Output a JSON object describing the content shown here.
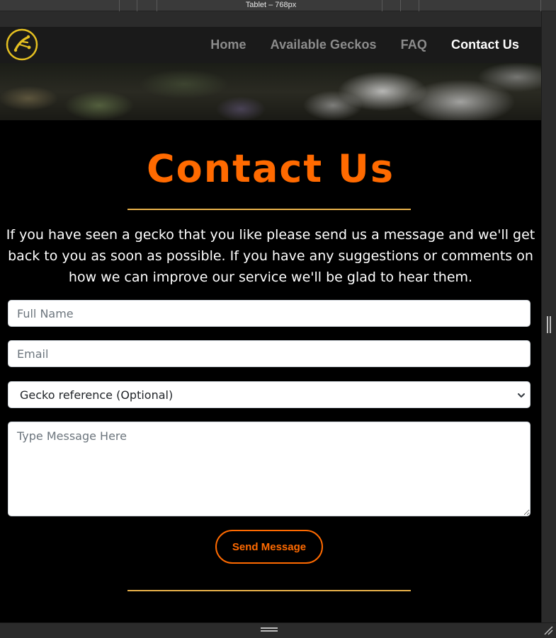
{
  "devtools": {
    "device_label": "Tablet – 768px"
  },
  "nav": {
    "links": [
      "Home",
      "Available Geckos",
      "FAQ",
      "Contact Us"
    ],
    "active": "Contact Us"
  },
  "page": {
    "title": "Contact Us",
    "intro": "If you have seen a gecko that you like please send us a message and we'll get back to you as soon as possible. If you have any suggestions or comments on how we can improve our service we'll be glad to hear them."
  },
  "form": {
    "name_placeholder": "Full Name",
    "email_placeholder": "Email",
    "gecko_select_value": "Gecko reference (Optional)",
    "message_placeholder": "Type Message Here",
    "submit_label": "Send Message"
  },
  "colors": {
    "accent": "#ff6a00",
    "divider": "#e8b14a",
    "logo": "#e5c021",
    "background": "#000000",
    "navbar": "#1a1a1a"
  },
  "icons": {
    "logo": "gecko-logo-icon",
    "select_arrow": "chevron-down-icon",
    "resize_grip": "resize-grip-icon"
  }
}
